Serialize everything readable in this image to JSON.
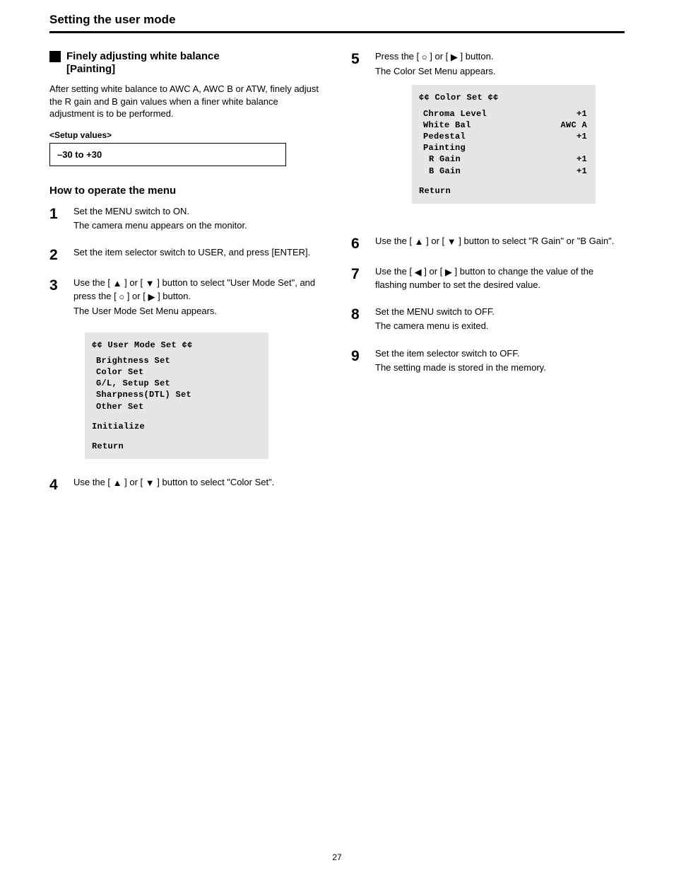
{
  "page": {
    "title": "Setting the user mode",
    "number": "27"
  },
  "section": {
    "heading": "Finely adjusting white balance\n[Painting]",
    "intro": "After setting white balance to AWC A, AWC B or ATW, finely adjust the R gain and B gain values when a finer white balance adjustment is to be performed.",
    "setup_label": "<Setup values>",
    "setup_text": "–30 to +30",
    "how_title": "How to operate the menu"
  },
  "steps": {
    "s1": "Set the MENU switch to ON.\nThe camera menu appears on the monitor.",
    "s2": "Set the item selector switch to USER, and press [ENTER].",
    "s3": {
      "line1": "Use the [",
      "line2": "] or [",
      "line3": "] button to select \"User Mode Set\", and press the [",
      "line4": "] or [",
      "line5": "] button.",
      "note": "The User Mode Set Menu appears."
    },
    "s4": {
      "pre": "Use the [",
      "mid": "] or [",
      "post": "] button to select \"Color Set\"."
    },
    "s5": {
      "pre": "Press the [",
      "mid": "] or [",
      "post": "] button.",
      "note": "The Color Set Menu appears."
    },
    "s6": {
      "pre": "Use the [",
      "mid": "] or [",
      "post": "] button to select \"R Gain\" or \"B Gain\"."
    },
    "s7": {
      "pre": "Use the [",
      "mid": "] or [",
      "post": "] button to change the value of the flashing number to set the desired value."
    },
    "s8": "Set the MENU switch to OFF.\nThe camera menu is exited.",
    "s9": "Set the item selector switch to OFF.\nThe setting made is stored in the memory."
  },
  "osd_user": {
    "title": "¢¢ User Mode Set ¢¢",
    "items": [
      "Brightness Set",
      "Color Set",
      "G/L, Setup Set",
      "Sharpness(DTL) Set",
      "Other Set"
    ],
    "initialize": "Initialize",
    "return": "Return"
  },
  "osd_color": {
    "title": "¢¢ Color Set ¢¢",
    "chroma_lab": "Chroma Level",
    "chroma_val": "+1",
    "wb_lab": "White Bal",
    "wb_val": "AWC A",
    "ped_lab": "Pedestal",
    "ped_val": "+1",
    "paint_lab": "Painting",
    "r_lab": "R Gain",
    "r_val": "+1",
    "b_lab": "B Gain",
    "b_val": "+1",
    "return": "Return"
  }
}
